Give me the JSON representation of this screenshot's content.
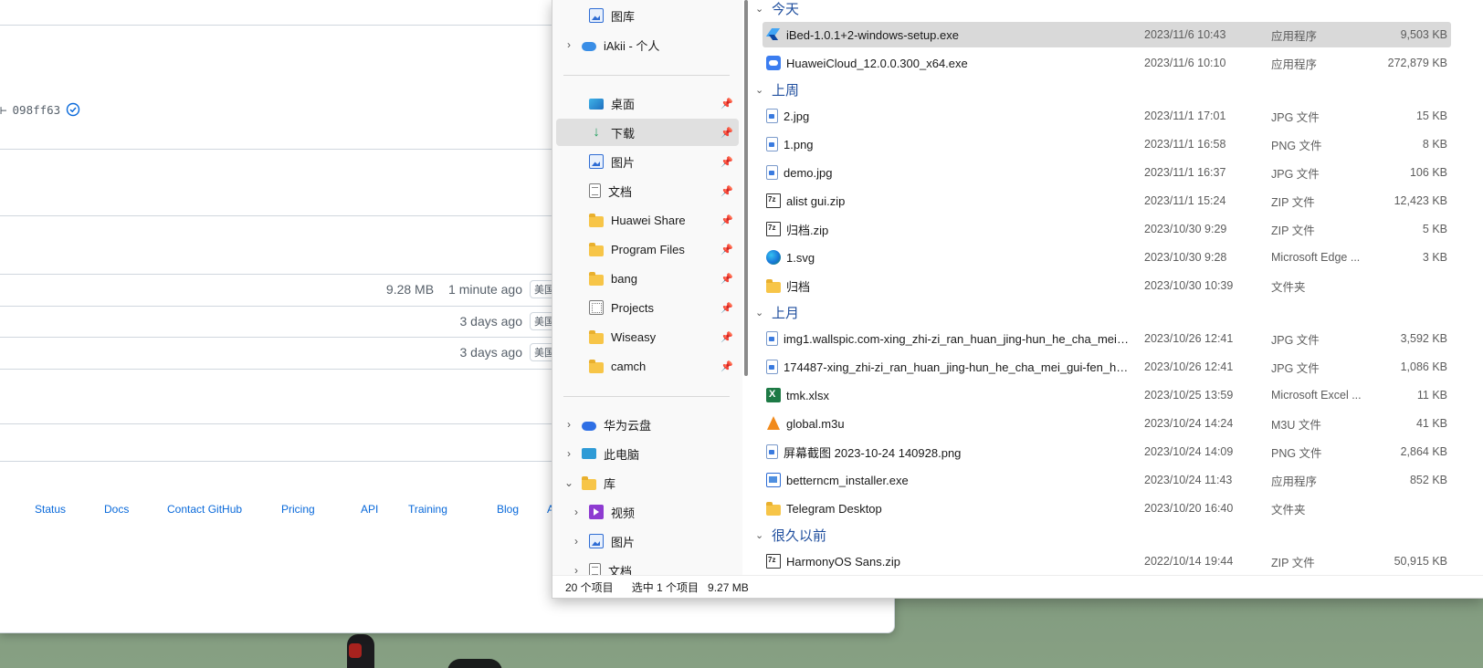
{
  "browser": {
    "commit": "098ff63",
    "rows": [
      {
        "size": "9.28 MB",
        "age": "1 minute ago",
        "tag": "美国"
      },
      {
        "size": "",
        "age": "3 days ago",
        "tag": "美国"
      },
      {
        "size": "",
        "age": "3 days ago",
        "tag": "美国"
      }
    ],
    "footer_links": [
      "Status",
      "Docs",
      "Contact GitHub",
      "Pricing",
      "API",
      "Training",
      "Blog",
      "A"
    ]
  },
  "explorer": {
    "nav": [
      {
        "label": "图库",
        "icon": "gallery-icon"
      },
      {
        "label": "iAkii - 个人",
        "icon": "onedrive-cloud-icon",
        "expandable": true
      },
      {
        "label": "桌面",
        "icon": "desktop-icon",
        "pinned": true
      },
      {
        "label": "下载",
        "icon": "download-icon",
        "pinned": true,
        "selected": true
      },
      {
        "label": "图片",
        "icon": "pictures-icon",
        "pinned": true
      },
      {
        "label": "文档",
        "icon": "documents-icon",
        "pinned": true
      },
      {
        "label": "Huawei Share",
        "icon": "folder-icon",
        "pinned": true
      },
      {
        "label": "Program Files",
        "icon": "folder-icon",
        "pinned": true
      },
      {
        "label": "bang",
        "icon": "folder-icon",
        "pinned": true
      },
      {
        "label": "Projects",
        "icon": "projects-icon",
        "pinned": true
      },
      {
        "label": "Wiseasy",
        "icon": "folder-icon",
        "pinned": true
      },
      {
        "label": "camch",
        "icon": "folder-icon",
        "pinned": true
      },
      {
        "label": "华为云盘",
        "icon": "huawei-cloud-icon",
        "expandable": true
      },
      {
        "label": "此电脑",
        "icon": "this-pc-icon",
        "expandable": true
      },
      {
        "label": "库",
        "icon": "library-folder-icon",
        "expanded": true
      },
      {
        "label": "视频",
        "icon": "videos-icon",
        "expandable": true
      },
      {
        "label": "图片",
        "icon": "pictures-icon",
        "expandable": true
      },
      {
        "label": "文档",
        "icon": "documents-icon",
        "expandable": true
      }
    ],
    "groups": [
      {
        "label": "今天",
        "files": [
          {
            "name": "iBed-1.0.1+2-windows-setup.exe",
            "date": "2023/11/6 10:43",
            "type": "应用程序",
            "size": "9,503 KB",
            "icon": "flutter-icon",
            "selected": true
          },
          {
            "name": "HuaweiCloud_12.0.0.300_x64.exe",
            "date": "2023/11/6 10:10",
            "type": "应用程序",
            "size": "272,879 KB",
            "icon": "huawei-cloud-app-icon"
          }
        ]
      },
      {
        "label": "上周",
        "files": [
          {
            "name": "2.jpg",
            "date": "2023/11/1 17:01",
            "type": "JPG 文件",
            "size": "15 KB",
            "icon": "image-file-icon"
          },
          {
            "name": "1.png",
            "date": "2023/11/1 16:58",
            "type": "PNG 文件",
            "size": "8 KB",
            "icon": "image-file-icon"
          },
          {
            "name": "demo.jpg",
            "date": "2023/11/1 16:37",
            "type": "JPG 文件",
            "size": "106 KB",
            "icon": "image-file-icon"
          },
          {
            "name": "alist gui.zip",
            "date": "2023/11/1 15:24",
            "type": "ZIP 文件",
            "size": "12,423 KB",
            "icon": "7zip-archive-icon"
          },
          {
            "name": "归档.zip",
            "date": "2023/10/30 9:29",
            "type": "ZIP 文件",
            "size": "5 KB",
            "icon": "7zip-archive-icon"
          },
          {
            "name": "1.svg",
            "date": "2023/10/30 9:28",
            "type": "Microsoft Edge ...",
            "size": "3 KB",
            "icon": "edge-icon"
          },
          {
            "name": "归档",
            "date": "2023/10/30 10:39",
            "type": "文件夹",
            "size": "",
            "icon": "folder-icon"
          }
        ]
      },
      {
        "label": "上月",
        "files": [
          {
            "name": "img1.wallspic.com-xing_zhi-zi_ran_huan_jing-hun_he_cha_mei_gui...",
            "date": "2023/10/26 12:41",
            "type": "JPG 文件",
            "size": "3,592 KB",
            "icon": "image-file-icon"
          },
          {
            "name": "174487-xing_zhi-zi_ran_huan_jing-hun_he_cha_mei_gui-fen_hong_...",
            "date": "2023/10/26 12:41",
            "type": "JPG 文件",
            "size": "1,086 KB",
            "icon": "image-file-icon"
          },
          {
            "name": "tmk.xlsx",
            "date": "2023/10/25 13:59",
            "type": "Microsoft Excel ...",
            "size": "11 KB",
            "icon": "excel-icon"
          },
          {
            "name": "global.m3u",
            "date": "2023/10/24 14:24",
            "type": "M3U 文件",
            "size": "41 KB",
            "icon": "vlc-icon"
          },
          {
            "name": "屏幕截图 2023-10-24 140928.png",
            "date": "2023/10/24 14:09",
            "type": "PNG 文件",
            "size": "2,864 KB",
            "icon": "image-file-icon"
          },
          {
            "name": "betterncm_installer.exe",
            "date": "2023/10/24 11:43",
            "type": "应用程序",
            "size": "852 KB",
            "icon": "exe-icon"
          },
          {
            "name": "Telegram Desktop",
            "date": "2023/10/20 16:40",
            "type": "文件夹",
            "size": "",
            "icon": "folder-icon"
          }
        ]
      },
      {
        "label": "很久以前",
        "files": [
          {
            "name": "HarmonyOS Sans.zip",
            "date": "2022/10/14 19:44",
            "type": "ZIP 文件",
            "size": "50,915 KB",
            "icon": "7zip-archive-icon"
          }
        ]
      }
    ],
    "status": {
      "count": "20 个项目",
      "selected": "选中 1 个项目",
      "selected_size": "9.27 MB"
    }
  }
}
